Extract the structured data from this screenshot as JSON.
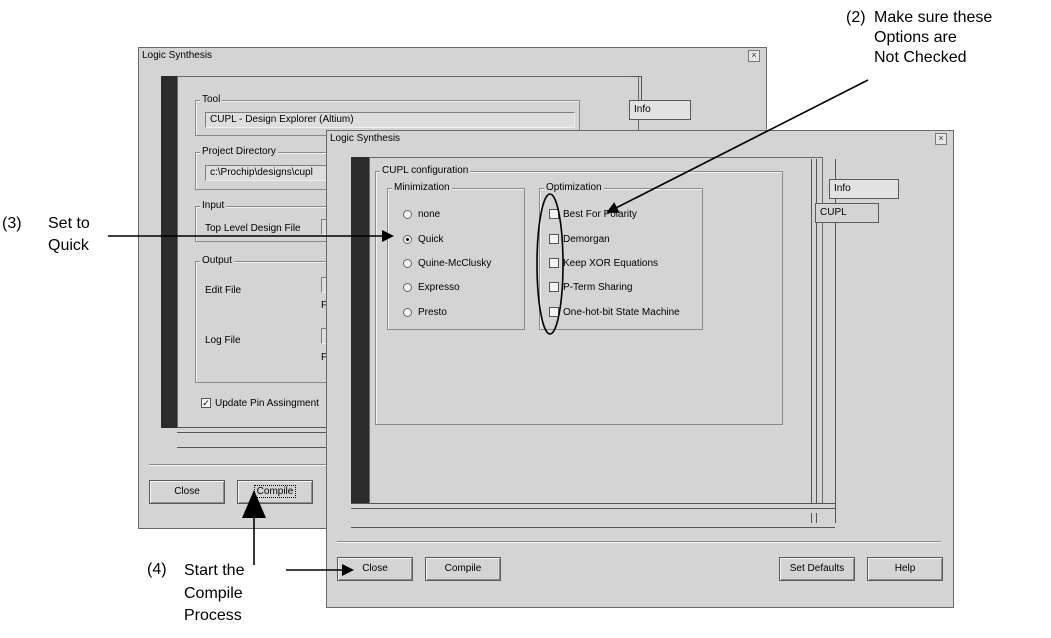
{
  "back_window": {
    "title": "Logic Synthesis",
    "close_glyph": "×",
    "tab_info": "Info",
    "tool_group": "Tool",
    "tool_value": "CUPL - Design Explorer (Altium)",
    "project_group": "Project Directory",
    "project_value": "c:\\Prochip\\designs\\cupl",
    "input_group": "Input",
    "top_level_label": "Top Level Design File",
    "output_group": "Output",
    "edit_file_label": "Edit File",
    "edit_file_sub": "F",
    "log_file_label": "Log File",
    "log_file_sub": "F",
    "update_pin_label": "Update Pin Assingment",
    "close_button": "Close",
    "compile_button": "Compile"
  },
  "front_window": {
    "title": "Logic Synthesis",
    "close_glyph": "×",
    "tab_info": "Info",
    "tab_cupl": "CUPL",
    "config_group": "CUPL configuration",
    "minimization_group": "Minimization",
    "minimization_options": [
      "none",
      "Quick",
      "Quine-McClusky",
      "Expresso",
      "Presto"
    ],
    "selected_minimization": "Quick",
    "optimization_group": "Optimization",
    "optimization_options": [
      "Best For Polarity",
      "Demorgan",
      "Keep XOR Equations",
      "P-Term Sharing",
      "One-hot-bit State Machine"
    ],
    "close_button": "Close",
    "compile_button": "Compile",
    "set_defaults_button": "Set Defaults",
    "help_button": "Help"
  },
  "annotations": {
    "a2_num": "(2)",
    "a2_lines": [
      "Make sure these",
      "Options are",
      "Not Checked"
    ],
    "a3_num": "(3)",
    "a3_lines": [
      "Set to",
      "Quick"
    ],
    "a4_num": "(4)",
    "a4_lines": [
      "Start the",
      "Compile",
      "Process"
    ]
  }
}
